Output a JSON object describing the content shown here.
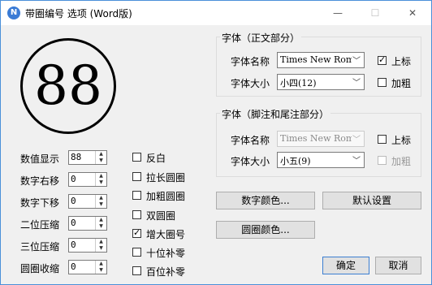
{
  "window": {
    "title": "带圈编号 选项 (Word版)",
    "app_icon": "N",
    "min_glyph": "—",
    "max_glyph": "☐",
    "close_glyph": "✕"
  },
  "preview": {
    "text": "88"
  },
  "left_fields": [
    {
      "label": "数值显示",
      "value": "88"
    },
    {
      "label": "数字右移",
      "value": "0"
    },
    {
      "label": "数字下移",
      "value": "0"
    },
    {
      "label": "二位压缩",
      "value": "0"
    },
    {
      "label": "三位压缩",
      "value": "0"
    },
    {
      "label": "圆圈收缩",
      "value": "0"
    }
  ],
  "options": [
    {
      "label": "反白",
      "checked": false
    },
    {
      "label": "拉长圆圈",
      "checked": false
    },
    {
      "label": "加粗圆圈",
      "checked": false
    },
    {
      "label": "双圆圈",
      "checked": false
    },
    {
      "label": "增大圈号",
      "checked": true
    },
    {
      "label": "十位补零",
      "checked": false
    },
    {
      "label": "百位补零",
      "checked": false
    }
  ],
  "font_body": {
    "title": "字体（正文部分）",
    "name_label": "字体名称",
    "name_value": "Times New Roman",
    "size_label": "字体大小",
    "size_value": "小四(12)",
    "superscript_label": "上标",
    "superscript_checked": true,
    "bold_label": "加粗",
    "bold_checked": false
  },
  "font_notes": {
    "title": "字体（脚注和尾注部分）",
    "name_label": "字体名称",
    "name_value": "Times New Roman",
    "size_label": "字体大小",
    "size_value": "小五(9)",
    "superscript_label": "上标",
    "superscript_checked": false,
    "bold_label": "加粗",
    "bold_checked": false
  },
  "buttons": {
    "digit_color": "数字颜色...",
    "default_settings": "默认设置",
    "circle_color": "圆圈颜色...",
    "ok": "确定",
    "cancel": "取消"
  },
  "glyphs": {
    "up": "▲",
    "down": "▼",
    "combo_arrow": "﹀"
  }
}
